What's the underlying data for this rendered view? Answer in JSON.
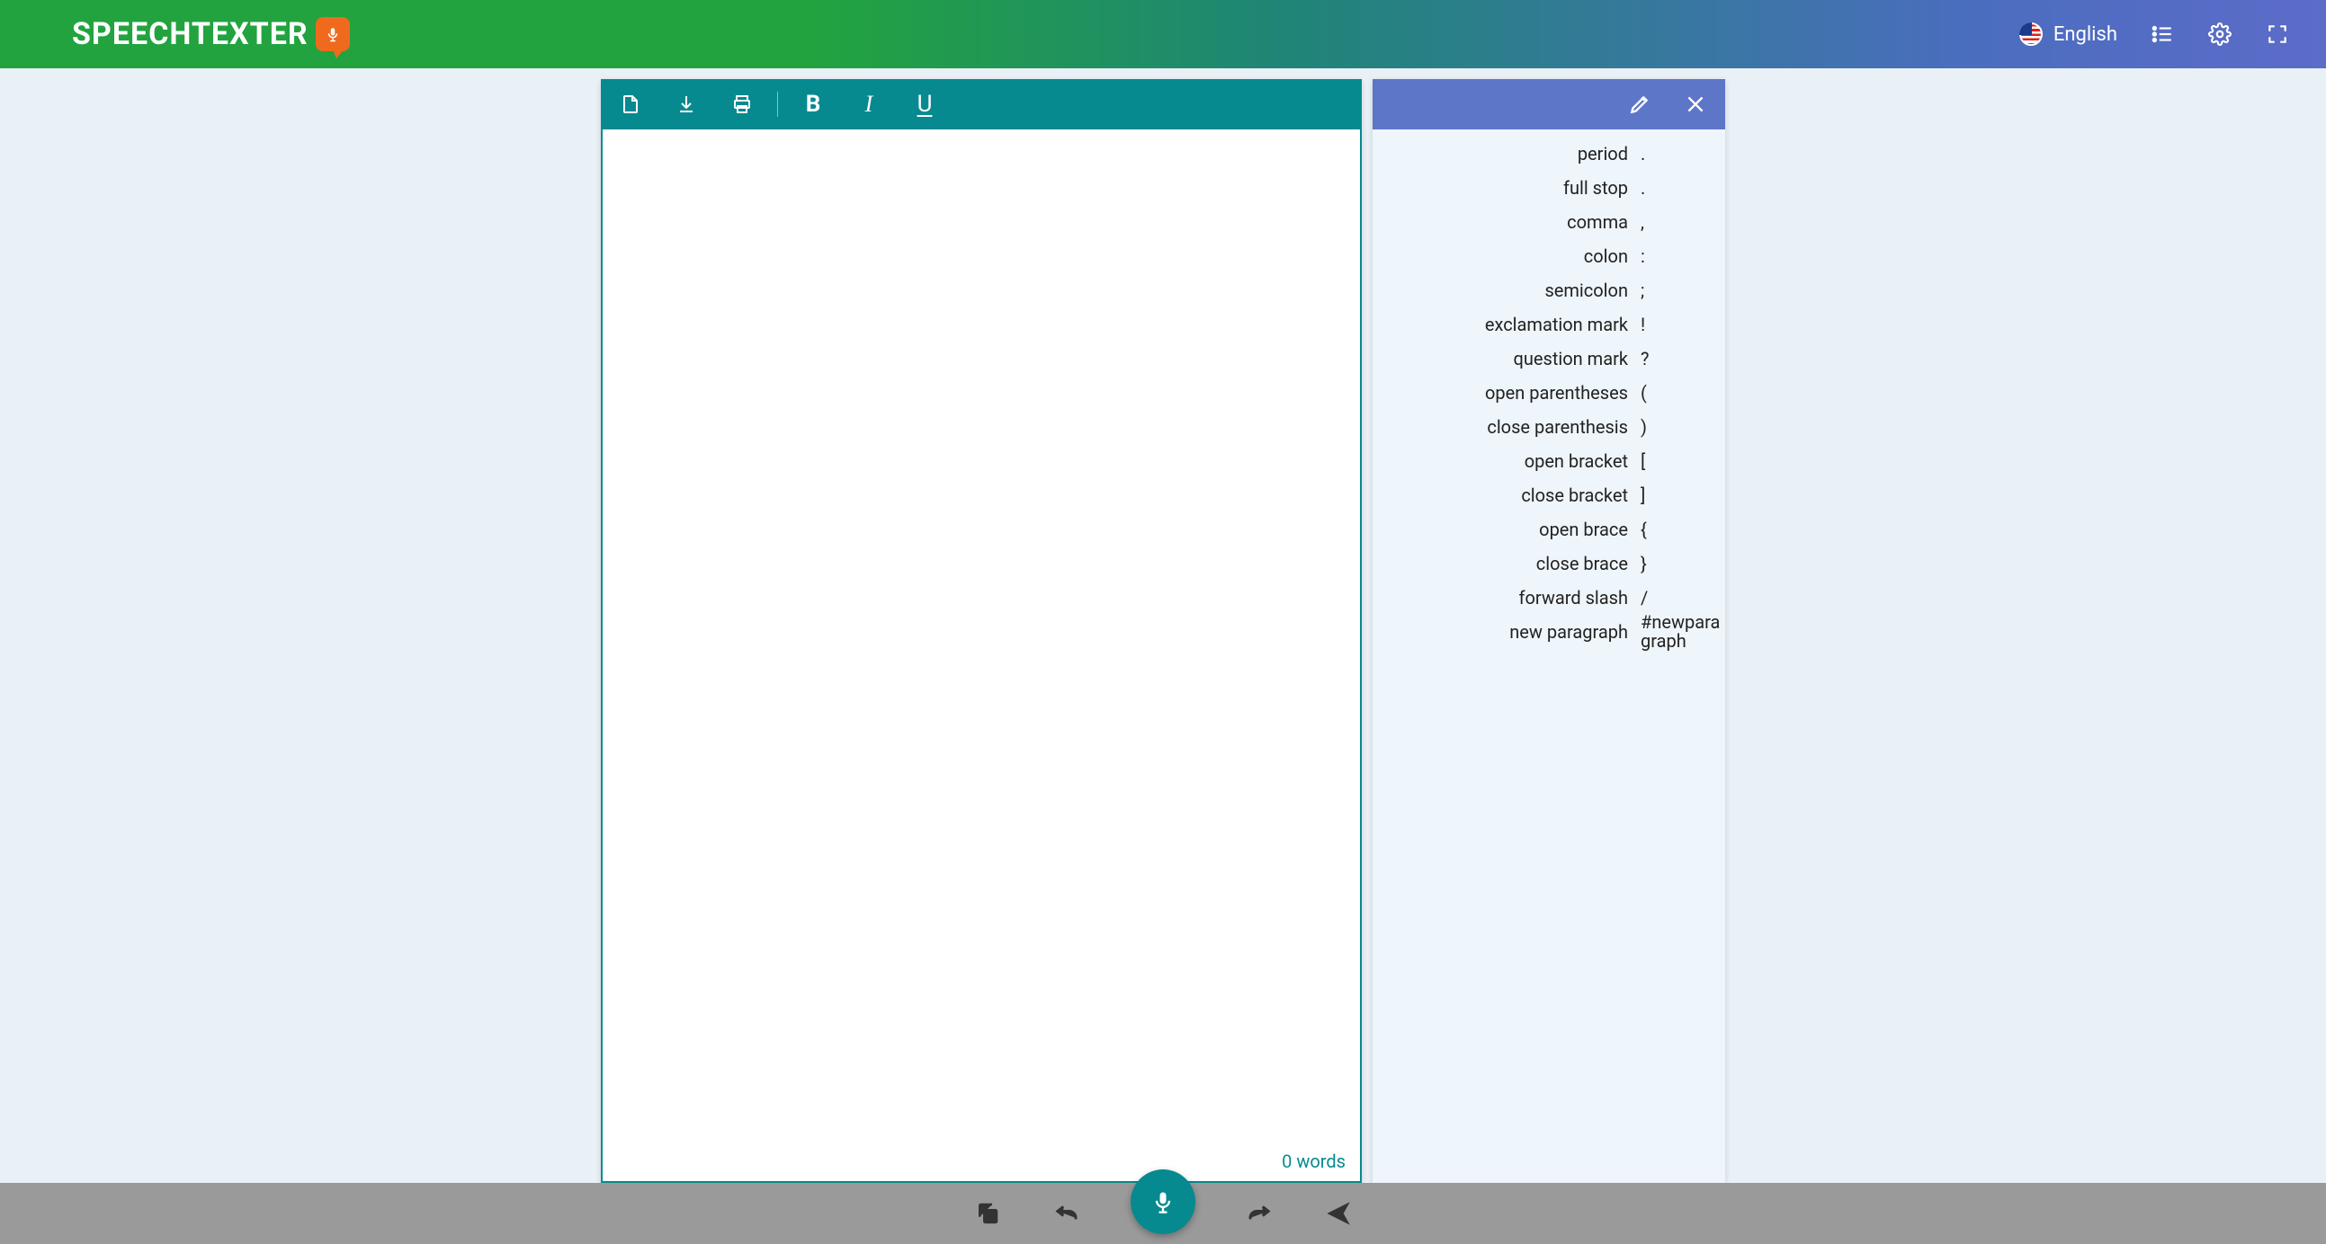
{
  "header": {
    "logo_text": "SPEECHTEXTER",
    "language_label": "English"
  },
  "editor": {
    "content": "",
    "word_count_label": "0 words"
  },
  "commands": [
    {
      "name": "period",
      "symbol": "."
    },
    {
      "name": "full stop",
      "symbol": "."
    },
    {
      "name": "comma",
      "symbol": ","
    },
    {
      "name": "colon",
      "symbol": ":"
    },
    {
      "name": "semicolon",
      "symbol": ";"
    },
    {
      "name": "exclamation mark",
      "symbol": "!"
    },
    {
      "name": "question mark",
      "symbol": "?"
    },
    {
      "name": "open parentheses",
      "symbol": "("
    },
    {
      "name": "close parenthesis",
      "symbol": ")"
    },
    {
      "name": "open bracket",
      "symbol": "["
    },
    {
      "name": "close bracket",
      "symbol": "]"
    },
    {
      "name": "open brace",
      "symbol": "{"
    },
    {
      "name": "close brace",
      "symbol": "}"
    },
    {
      "name": "forward slash",
      "symbol": "/"
    },
    {
      "name": "new paragraph",
      "symbol": "#newparagraph"
    }
  ]
}
